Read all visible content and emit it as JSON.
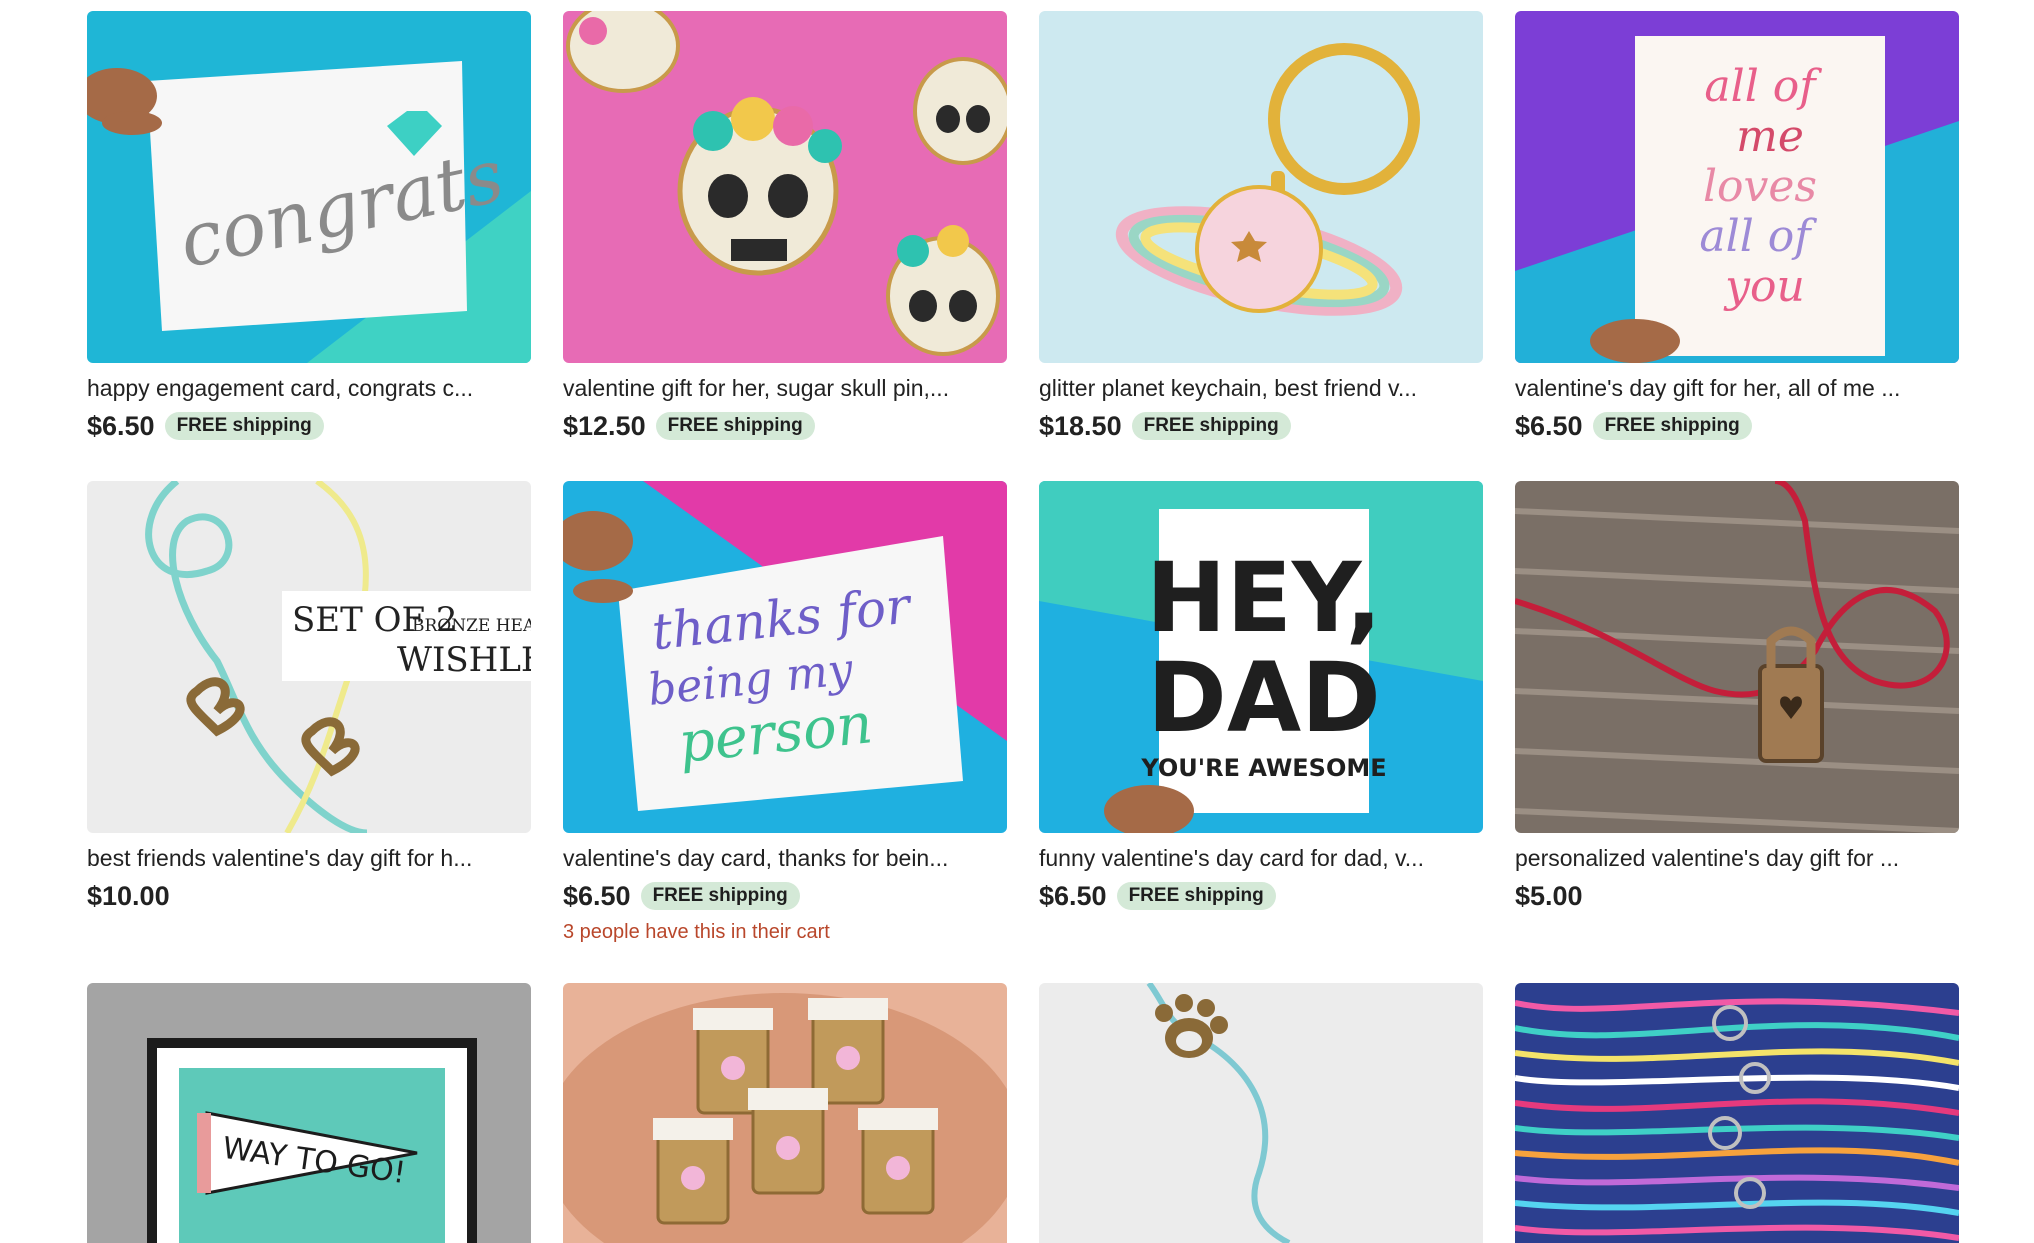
{
  "listings": [
    {
      "title": "happy engagement card, congrats c...",
      "price": "$6.50",
      "badge": "FREE shipping",
      "image": "congrats-card"
    },
    {
      "title": "valentine gift for her, sugar skull pin,...",
      "price": "$12.50",
      "badge": "FREE shipping",
      "image": "sugar-skull-pins"
    },
    {
      "title": "glitter planet keychain, best friend v...",
      "price": "$18.50",
      "badge": "FREE shipping",
      "image": "planet-keychain"
    },
    {
      "title": "valentine's day gift for her, all of me ...",
      "price": "$6.50",
      "badge": "FREE shipping",
      "image": "all-of-me-card"
    },
    {
      "title": "best friends valentine's day gift for h...",
      "price": "$10.00",
      "badge": "",
      "image": "heart-wishlets"
    },
    {
      "title": "valentine's day card, thanks for bein...",
      "price": "$6.50",
      "badge": "FREE shipping",
      "note": "3 people have this in their cart",
      "image": "thanks-card"
    },
    {
      "title": "funny valentine's day card for dad, v...",
      "price": "$6.50",
      "badge": "FREE shipping",
      "image": "hey-dad-card"
    },
    {
      "title": "personalized valentine's day gift for ...",
      "price": "$5.00",
      "badge": "",
      "image": "lock-bracelet"
    },
    {
      "image": "way-to-go-print"
    },
    {
      "image": "coffee-cup-pins"
    },
    {
      "image": "paw-bracelet"
    },
    {
      "image": "colorful-threads"
    }
  ],
  "image_text": {
    "congrats": "congrats",
    "wishlets_line1": "SET OF 2",
    "wishlets_small": "BRONZE HEART",
    "wishlets_line2": "WISHLETS",
    "all_of_me": [
      "all of",
      "me",
      "loves",
      "all of",
      "you"
    ],
    "thanks": [
      "thanks for",
      "being my",
      "person"
    ],
    "hey": "HEY,",
    "dad": "DAD",
    "awesome": "YOU'RE AWESOME",
    "way_to_go": "WAY TO GO!"
  }
}
